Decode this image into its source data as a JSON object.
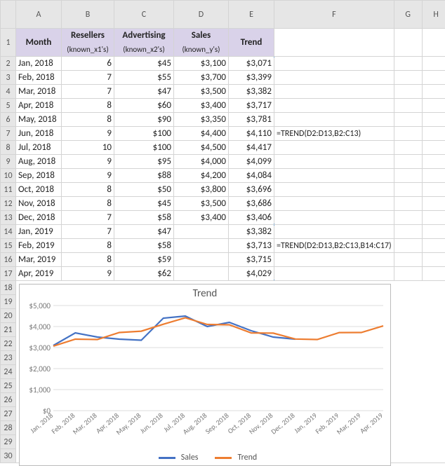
{
  "columns": [
    "",
    "A",
    "B",
    "C",
    "D",
    "E",
    "F",
    "G",
    "H"
  ],
  "header1": {
    "A": "Month",
    "B": "Resellers",
    "C": "Advertising",
    "D": "Sales",
    "E": "Trend"
  },
  "header2": {
    "B": "(known_x1's)",
    "C": "(known_x2's)",
    "D": "(known_y's)"
  },
  "rows": [
    {
      "n": 2,
      "A": "Jan, 2018",
      "B": "6",
      "C": "$45",
      "D": "$3,100",
      "E": "$3,071"
    },
    {
      "n": 3,
      "A": "Feb, 2018",
      "B": "7",
      "C": "$55",
      "D": "$3,700",
      "E": "$3,399"
    },
    {
      "n": 4,
      "A": "Mar, 2018",
      "B": "7",
      "C": "$47",
      "D": "$3,500",
      "E": "$3,382"
    },
    {
      "n": 5,
      "A": "Apr, 2018",
      "B": "8",
      "C": "$60",
      "D": "$3,400",
      "E": "$3,717"
    },
    {
      "n": 6,
      "A": "May, 2018",
      "B": "8",
      "C": "$90",
      "D": "$3,350",
      "E": "$3,781"
    },
    {
      "n": 7,
      "A": "Jun, 2018",
      "B": "9",
      "C": "$100",
      "D": "$4,400",
      "E": "$4,110",
      "F": "=TREND(D2:D13,B2:C13)"
    },
    {
      "n": 8,
      "A": "Jul, 2018",
      "B": "10",
      "C": "$100",
      "D": "$4,500",
      "E": "$4,417"
    },
    {
      "n": 9,
      "A": "Aug, 2018",
      "B": "9",
      "C": "$95",
      "D": "$4,000",
      "E": "$4,099"
    },
    {
      "n": 10,
      "A": "Sep, 2018",
      "B": "9",
      "C": "$88",
      "D": "$4,200",
      "E": "$4,084"
    },
    {
      "n": 11,
      "A": "Oct, 2018",
      "B": "8",
      "C": "$50",
      "D": "$3,800",
      "E": "$3,696"
    },
    {
      "n": 12,
      "A": "Nov, 2018",
      "B": "8",
      "C": "$45",
      "D": "$3,500",
      "E": "$3,686"
    },
    {
      "n": 13,
      "A": "Dec, 2018",
      "B": "7",
      "C": "$58",
      "D": "$3,400",
      "E": "$3,406"
    },
    {
      "n": 14,
      "A": "Jan, 2019",
      "B": "7",
      "C": "$47",
      "D": "",
      "E": "$3,382"
    },
    {
      "n": 15,
      "A": "Feb, 2019",
      "B": "8",
      "C": "$58",
      "D": "",
      "E": "$3,713",
      "F": "=TREND(D2:D13,B2:C13,B14:C17)"
    },
    {
      "n": 16,
      "A": "Mar, 2019",
      "B": "8",
      "C": "$59",
      "D": "",
      "E": "$3,715"
    },
    {
      "n": 17,
      "A": "Apr, 2019",
      "B": "9",
      "C": "$62",
      "D": "",
      "E": "$4,029"
    }
  ],
  "empty_rows": [
    18,
    19,
    20,
    21,
    22,
    23,
    24,
    25,
    26,
    27,
    28,
    29,
    30
  ],
  "chart": {
    "title": "Trend",
    "legend": {
      "s1": "Sales",
      "s2": "Trend"
    },
    "colors": {
      "sales": "#4472c4",
      "trend": "#ed7d31"
    }
  },
  "chart_data": {
    "type": "line",
    "title": "Trend",
    "xlabel": "",
    "ylabel": "",
    "ylim": [
      0,
      5000
    ],
    "yticks": [
      "$0",
      "$1,000",
      "$2,000",
      "$3,000",
      "$4,000",
      "$5,000"
    ],
    "categories": [
      "Jan, 2018",
      "Feb, 2018",
      "Mar, 2018",
      "Apr, 2018",
      "May, 2018",
      "Jun, 2018",
      "Jul, 2018",
      "Aug, 2018",
      "Sep, 2018",
      "Oct, 2018",
      "Nov, 2018",
      "Dec, 2018",
      "Jan, 2019",
      "Feb, 2019",
      "Mar, 2019",
      "Apr, 2019"
    ],
    "series": [
      {
        "name": "Sales",
        "values": [
          3100,
          3700,
          3500,
          3400,
          3350,
          4400,
          4500,
          4000,
          4200,
          3800,
          3500,
          3400,
          null,
          null,
          null,
          null
        ]
      },
      {
        "name": "Trend",
        "values": [
          3071,
          3399,
          3382,
          3717,
          3781,
          4110,
          4417,
          4099,
          4084,
          3696,
          3686,
          3406,
          3382,
          3713,
          3715,
          4029
        ]
      }
    ]
  }
}
